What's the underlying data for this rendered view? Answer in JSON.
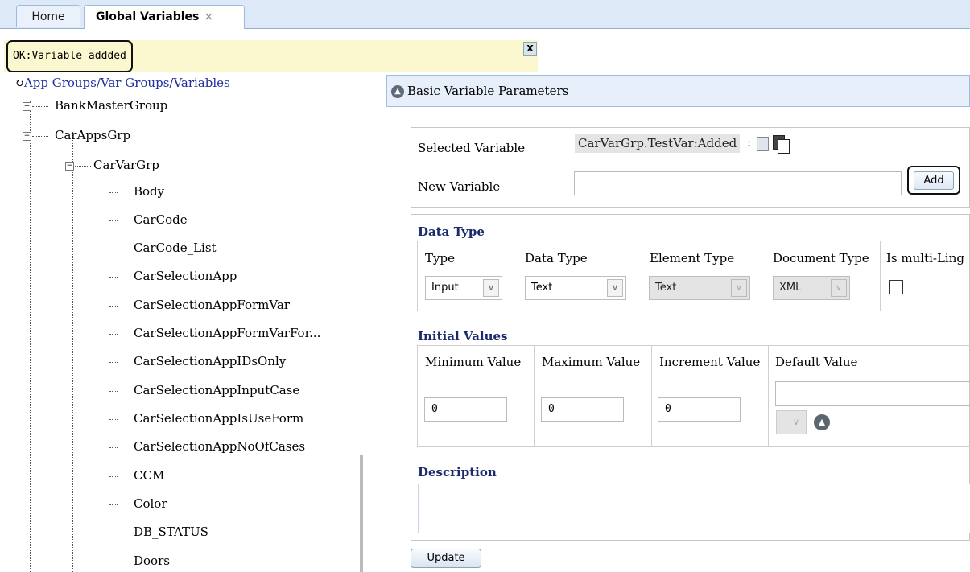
{
  "tabs": [
    {
      "label": "Home"
    },
    {
      "label": "Global Variables",
      "close": "×"
    }
  ],
  "notification": {
    "text": "OK:Variable addded",
    "close": "X"
  },
  "tree": {
    "root_label": "App Groups/Var Groups/Variables",
    "groups": [
      {
        "label": "BankMasterGroup",
        "expander": "+"
      },
      {
        "label": "CarAppsGrp",
        "expander": "−"
      }
    ],
    "subgroup": {
      "label": "CarVarGrp",
      "expander": "−"
    },
    "variables": [
      "Body",
      "CarCode",
      "CarCode_List",
      "CarSelectionApp",
      "CarSelectionAppFormVar",
      "CarSelectionAppFormVarFor...",
      "CarSelectionAppIDsOnly",
      "CarSelectionAppInputCase",
      "CarSelectionAppIsUseForm",
      "CarSelectionAppNoOfCases",
      "CCM",
      "Color",
      "DB_STATUS",
      "Doors"
    ]
  },
  "panel": {
    "title": "Basic Variable Parameters",
    "selected_variable_label": "Selected Variable",
    "selected_variable_value": "CarVarGrp.TestVar:Added",
    "selected_variable_sep": ":",
    "new_variable_label": "New Variable",
    "new_variable_value": "",
    "add_label": "Add",
    "data_type_section": "Data Type",
    "data_type_columns": [
      "Type",
      "Data Type",
      "Element Type",
      "Document Type",
      "Is multi-Ling"
    ],
    "type_value": "Input",
    "data_type_value": "Text",
    "element_type_value": "Text",
    "document_type_value": "XML",
    "is_multilingual_checked": false,
    "initial_values_section": "Initial Values",
    "initial_values_columns": [
      "Minimum Value",
      "Maximum Value",
      "Increment Value",
      "Default Value"
    ],
    "minimum_value": "0",
    "maximum_value": "0",
    "increment_value": "0",
    "default_value": "",
    "description_section": "Description",
    "description_value": "",
    "update_label": "Update"
  },
  "icons": {
    "dropdown_arrow": "chevron-down-icon",
    "panel_collapse": "chevron-up-circle-icon",
    "refresh": "refresh-icon",
    "copy": "copy-icon",
    "paste": "paste-icon"
  }
}
